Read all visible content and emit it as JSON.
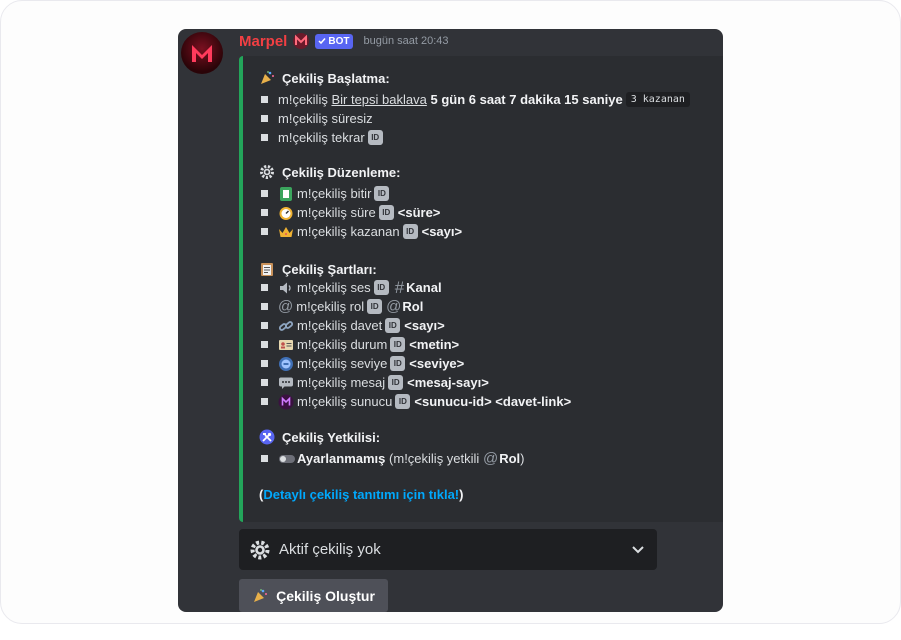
{
  "message": {
    "author": "Marpel",
    "bot_tag": "BOT",
    "timestamp": "bugün saat 20:43"
  },
  "sections": {
    "start": {
      "title": "Çekiliş Başlatma:",
      "items": [
        {
          "cmd": "m!çekiliş",
          "link": "Bir tepsi baklava",
          "duration": "5 gün 6 saat 7 dakika 15 saniye",
          "code": "3 kazanan"
        },
        {
          "cmd": "m!çekiliş süresiz"
        },
        {
          "cmd": "m!çekiliş tekrar"
        }
      ]
    },
    "edit": {
      "title": "Çekiliş Düzenleme:",
      "items": [
        {
          "cmd": "m!çekiliş bitir"
        },
        {
          "cmd": "m!çekiliş süre",
          "arg": "<süre>"
        },
        {
          "cmd": "m!çekiliş kazanan",
          "arg": "<sayı>"
        }
      ]
    },
    "terms": {
      "title": "Çekiliş Şartları:",
      "items": [
        {
          "cmd": "m!çekiliş ses",
          "arg": "Kanal"
        },
        {
          "cmd": "m!çekiliş rol",
          "arg": "Rol"
        },
        {
          "cmd": "m!çekiliş davet",
          "arg": "<sayı>"
        },
        {
          "cmd": "m!çekiliş durum",
          "arg": "<metin>"
        },
        {
          "cmd": "m!çekiliş seviye",
          "arg": "<seviye>"
        },
        {
          "cmd": "m!çekiliş mesaj",
          "arg": "<mesaj-sayı>"
        },
        {
          "cmd": "m!çekiliş sunucu",
          "arg": "<sunucu-id>",
          "arg2": "<davet-link>"
        }
      ]
    },
    "admin": {
      "title": "Çekiliş Yetkilisi:",
      "status": "Ayarlanmamış",
      "cmd_open": "(m!çekiliş yetkili",
      "role": "Rol",
      "cmd_close": ")"
    }
  },
  "details": {
    "open": "(",
    "link": "Detaylı çekiliş tanıtımı için tıkla!",
    "close": ")"
  },
  "select": {
    "label": "Aktif çekiliş yok"
  },
  "button": {
    "label": "Çekiliş Oluştur"
  },
  "id_badge": "ID",
  "colors": {
    "accent_bar": "#23a55a",
    "username": "#f23f43",
    "bot_tag": "#5865f2",
    "link": "#00a8fc"
  }
}
